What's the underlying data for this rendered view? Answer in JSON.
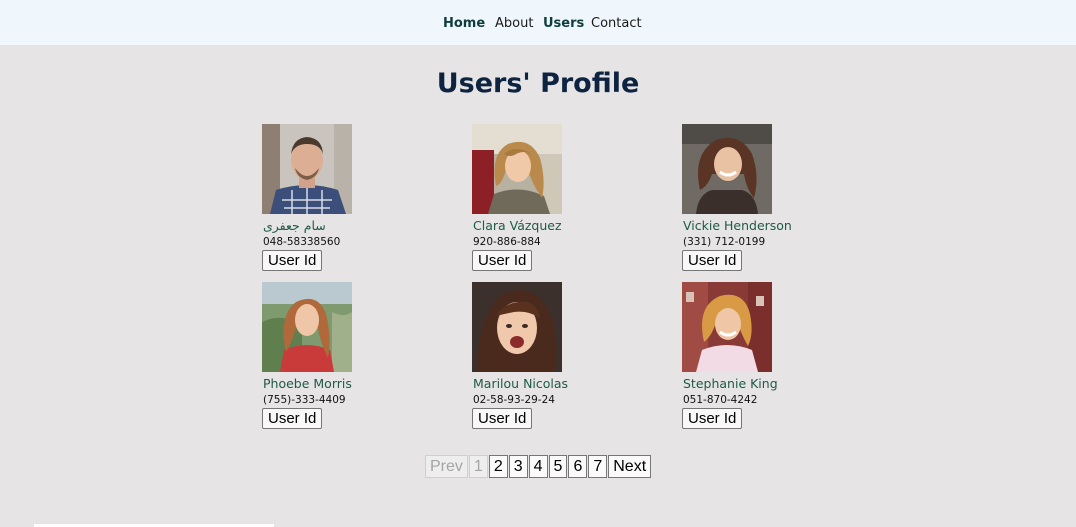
{
  "nav": {
    "items": [
      "Home",
      "About",
      "Users",
      "Contact"
    ]
  },
  "page": {
    "title": "Users' Profile"
  },
  "users": [
    {
      "name": "سام جعفری",
      "phone": "048-58338560",
      "button": "User Id"
    },
    {
      "name": "Clara Vázquez",
      "phone": "920-886-884",
      "button": "User Id"
    },
    {
      "name": "Vickie Henderson",
      "phone": "(331) 712-0199",
      "button": "User Id"
    },
    {
      "name": "Phoebe Morris",
      "phone": "(755)-333-4409",
      "button": "User Id"
    },
    {
      "name": "Marilou Nicolas",
      "phone": "02-58-93-29-24",
      "button": "User Id"
    },
    {
      "name": "Stephanie King",
      "phone": "051-870-4242",
      "button": "User Id"
    }
  ],
  "pagination": {
    "prev": "Prev",
    "pages": [
      "1",
      "2",
      "3",
      "4",
      "5",
      "6",
      "7"
    ],
    "current_page": 1,
    "next": "Next"
  },
  "colors": {
    "nav_background": "#eff7fc",
    "page_background": "#e6e4e5",
    "title": "#0d2340",
    "name_text": "#1f5a45",
    "active_nav": "#0f3d3e"
  }
}
